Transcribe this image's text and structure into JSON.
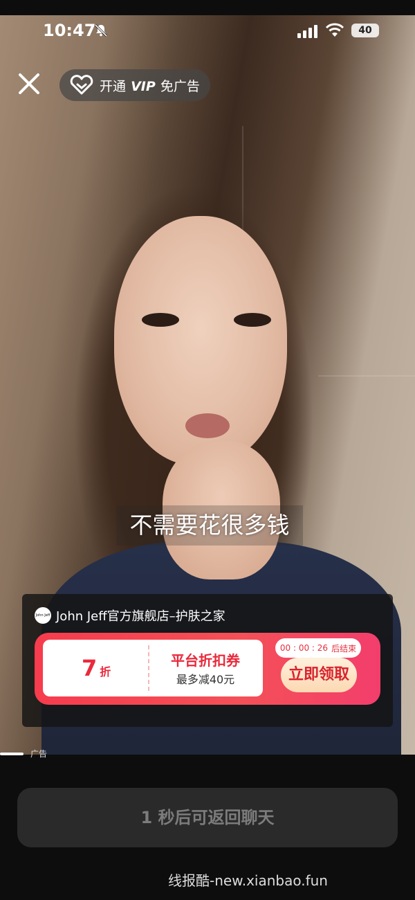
{
  "status_bar": {
    "time": "10:47",
    "battery": "40"
  },
  "top": {
    "vip_prefix": "开通",
    "vip_word": "VIP",
    "vip_suffix": "免广告"
  },
  "video": {
    "subtitle": "不需要花很多钱"
  },
  "ad_card": {
    "store_name": "John Jeff官方旗舰店–护肤之家",
    "store_logo_text": "John Jeff",
    "discount_value": "7",
    "discount_unit": "折",
    "coupon_title": "平台折扣券",
    "coupon_subtitle": "最多减40元",
    "countdown": "00 : 00 : 26",
    "countdown_suffix": "后结束",
    "claim_label": "立即领取"
  },
  "ad_label": "广告",
  "return_button": "1 秒后可返回聊天",
  "watermark": "线报酷-new.xianbao.fun",
  "colors": {
    "coupon_red": "#f63c4d",
    "claim_text": "#d9222f",
    "button_bg": "#2a2a2a"
  }
}
